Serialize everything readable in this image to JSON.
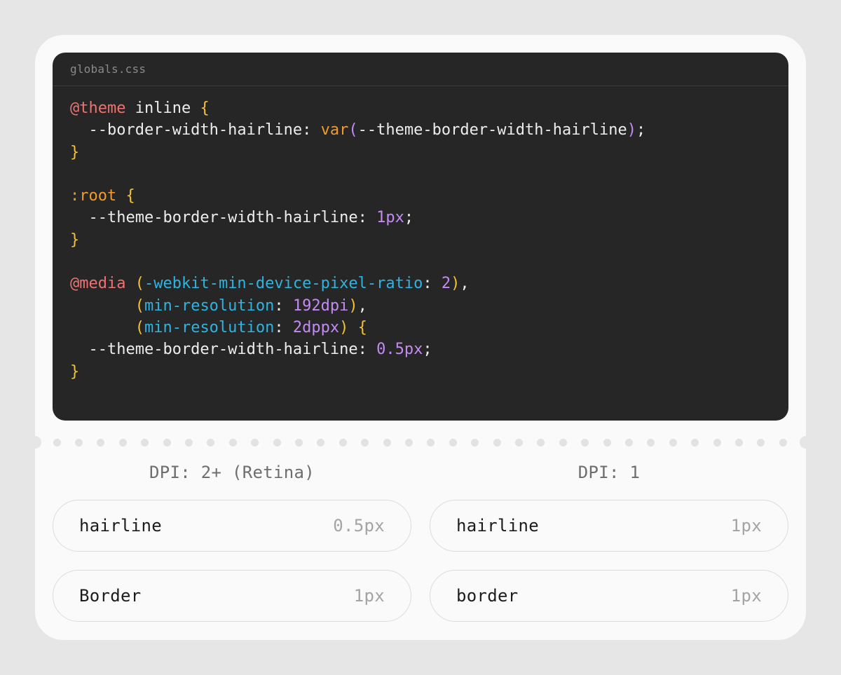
{
  "editor": {
    "filename": "globals.css",
    "lines": [
      [
        {
          "t": "@theme",
          "c": "c-at"
        },
        {
          "t": " inline ",
          "c": ""
        },
        {
          "t": "{",
          "c": "c-brace"
        }
      ],
      [
        {
          "t": "  --border-width-hairline: ",
          "c": ""
        },
        {
          "t": "var",
          "c": "c-sel"
        },
        {
          "t": "(",
          "c": "c-paren"
        },
        {
          "t": "--theme-border-width-hairline",
          "c": ""
        },
        {
          "t": ")",
          "c": "c-paren"
        },
        {
          "t": ";",
          "c": ""
        }
      ],
      [
        {
          "t": "}",
          "c": "c-brace"
        }
      ],
      [],
      [
        {
          "t": ":root",
          "c": "c-sel"
        },
        {
          "t": " ",
          "c": ""
        },
        {
          "t": "{",
          "c": "c-brace"
        }
      ],
      [
        {
          "t": "  --theme-border-width-hairline: ",
          "c": ""
        },
        {
          "t": "1px",
          "c": "c-num"
        },
        {
          "t": ";",
          "c": ""
        }
      ],
      [
        {
          "t": "}",
          "c": "c-brace"
        }
      ],
      [],
      [
        {
          "t": "@media",
          "c": "c-at"
        },
        {
          "t": " ",
          "c": ""
        },
        {
          "t": "(",
          "c": "c-brace"
        },
        {
          "t": "-webkit-min-device-pixel-ratio",
          "c": "c-media"
        },
        {
          "t": ": ",
          "c": ""
        },
        {
          "t": "2",
          "c": "c-num"
        },
        {
          "t": ")",
          "c": "c-brace"
        },
        {
          "t": ",",
          "c": ""
        }
      ],
      [
        {
          "t": "       ",
          "c": ""
        },
        {
          "t": "(",
          "c": "c-brace"
        },
        {
          "t": "min-resolution",
          "c": "c-media"
        },
        {
          "t": ": ",
          "c": ""
        },
        {
          "t": "192dpi",
          "c": "c-num"
        },
        {
          "t": ")",
          "c": "c-brace"
        },
        {
          "t": ",",
          "c": ""
        }
      ],
      [
        {
          "t": "       ",
          "c": ""
        },
        {
          "t": "(",
          "c": "c-brace"
        },
        {
          "t": "min-resolution",
          "c": "c-media"
        },
        {
          "t": ": ",
          "c": ""
        },
        {
          "t": "2dppx",
          "c": "c-num"
        },
        {
          "t": ")",
          "c": "c-brace"
        },
        {
          "t": " ",
          "c": ""
        },
        {
          "t": "{",
          "c": "c-brace"
        }
      ],
      [
        {
          "t": "  --theme-border-width-hairline: ",
          "c": ""
        },
        {
          "t": "0.5px",
          "c": "c-num"
        },
        {
          "t": ";",
          "c": ""
        }
      ],
      [
        {
          "t": "}",
          "c": "c-brace"
        }
      ]
    ]
  },
  "comparison": {
    "left": {
      "title": "DPI: 2+ (Retina)",
      "rows": [
        {
          "label": "hairline",
          "value": "0.5px"
        },
        {
          "label": "Border",
          "value": "1px"
        }
      ]
    },
    "right": {
      "title": "DPI: 1",
      "rows": [
        {
          "label": "hairline",
          "value": "1px"
        },
        {
          "label": "border",
          "value": "1px"
        }
      ]
    }
  },
  "colors": {
    "at_rule": "#f0716f",
    "brace": "#f3c233",
    "selector": "#f39a2b",
    "number": "#c38bf3",
    "media_feature": "#2fb3e0",
    "code_background": "#262626"
  }
}
